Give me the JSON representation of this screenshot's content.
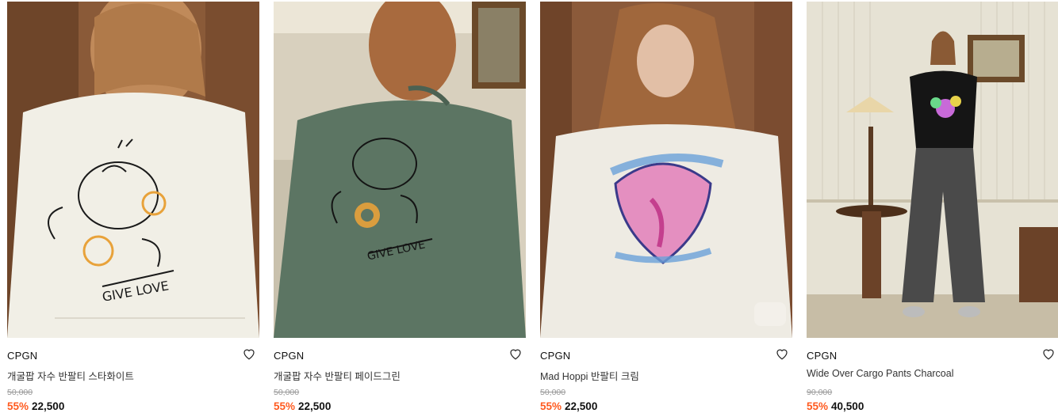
{
  "products": [
    {
      "brand": "CPGN",
      "name": "개굴팝 자수 반팔티 스타화이트",
      "original_price": "50,000",
      "discount": "55%",
      "price": "22,500",
      "shirt_color": "#f1efe6",
      "bg_color": "#8a5a38",
      "print_text": "GIVE LOVE"
    },
    {
      "brand": "CPGN",
      "name": "개굴팝 자수 반팔티 페이드그린",
      "original_price": "50,000",
      "discount": "55%",
      "price": "22,500",
      "shirt_color": "#5c7563",
      "bg_color": "#d8d0be",
      "print_text": "GIVE LOVE"
    },
    {
      "brand": "CPGN",
      "name": "Mad Hoppi 반팔티 크림",
      "original_price": "50,000",
      "discount": "55%",
      "price": "22,500",
      "shirt_color": "#eeebe3",
      "bg_color": "#8b5a3a"
    },
    {
      "brand": "CPGN",
      "name": "Wide Over Cargo Pants Charcoal",
      "original_price": "90,000",
      "discount": "55%",
      "price": "40,500",
      "shirt_color": "#151515",
      "bg_color": "#e6e2d4"
    }
  ],
  "icons": {
    "wishlist": "heart-outline-icon"
  }
}
